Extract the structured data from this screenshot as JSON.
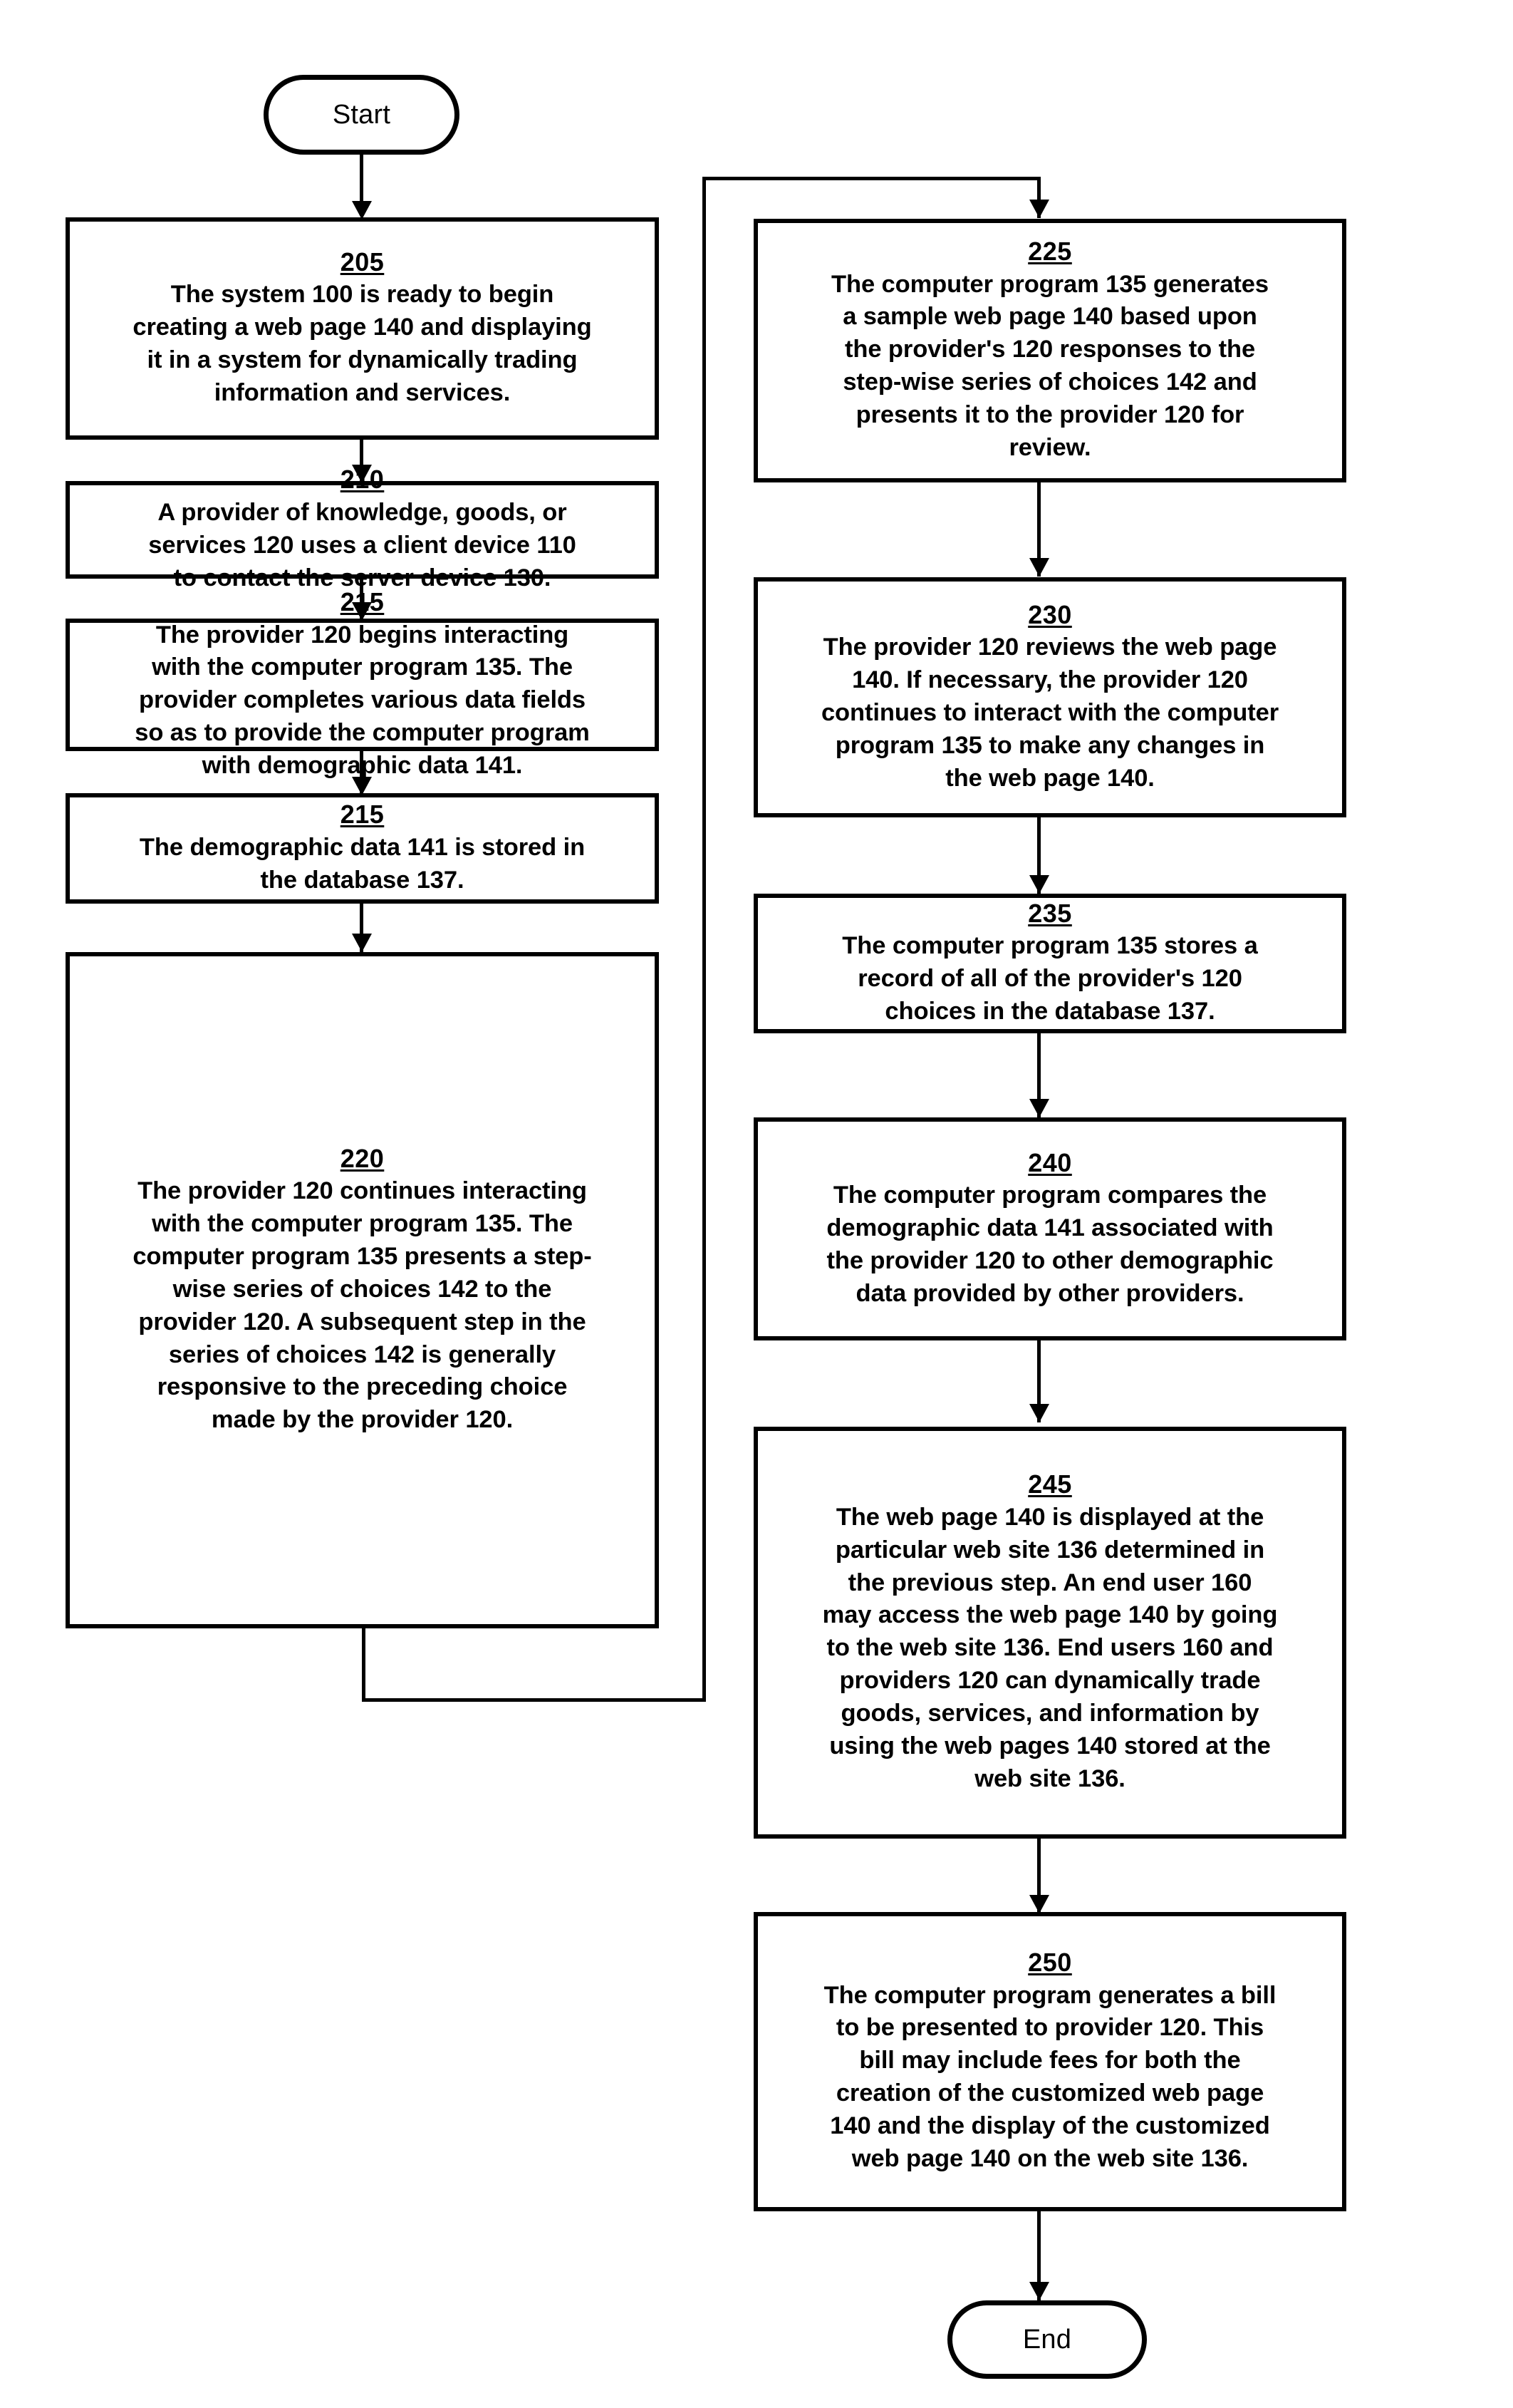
{
  "figure": {
    "type": "patent-flowchart",
    "orientation": "two-column"
  },
  "nodes": {
    "start": {
      "label": "Start"
    },
    "end": {
      "label": "End"
    },
    "steps": [
      {
        "id": "205",
        "number": "205",
        "text": "The system 100 is ready to begin\ncreating a web page 140 and displaying\nit in a system for dynamically trading\ninformation and services."
      },
      {
        "id": "210",
        "number": "210",
        "text": "A provider of knowledge, goods, or\nservices 120 uses a client device 110\nto contact the server device 130."
      },
      {
        "id": "215a",
        "number": "215",
        "text": "The provider 120 begins interacting\nwith the computer program 135.  The\nprovider completes various data fields\nso as to provide the computer program\nwith demographic data 141."
      },
      {
        "id": "215b",
        "number": "215",
        "text": "The demographic data 141 is stored in\nthe database 137."
      },
      {
        "id": "220",
        "number": "220",
        "text": "The provider 120 continues interacting\nwith the computer program 135.  The\ncomputer program 135 presents a step-\nwise series of choices 142 to the\nprovider 120.  A subsequent step in the\nseries of choices 142 is generally\nresponsive to the preceding choice\nmade by the provider 120."
      },
      {
        "id": "225",
        "number": "225",
        "text": "The computer program 135 generates\na sample web page 140 based upon\nthe provider's 120 responses to the\nstep-wise series of choices 142 and\npresents it to the provider 120 for\nreview."
      },
      {
        "id": "230",
        "number": "230",
        "text": "The provider 120 reviews the web page\n140.  If necessary, the provider 120\ncontinues to interact with the computer\nprogram 135 to make any changes in\nthe web page 140."
      },
      {
        "id": "235",
        "number": "235",
        "text": "The computer program 135 stores a\nrecord of all of the provider's 120\nchoices in the database 137."
      },
      {
        "id": "240",
        "number": "240",
        "text": "The computer program compares the\ndemographic data 141 associated with\nthe provider 120 to other demographic\ndata provided by other providers."
      },
      {
        "id": "245",
        "number": "245",
        "text": "The web page 140 is displayed at the\nparticular web site 136 determined in\nthe previous step.  An end user 160\nmay access the web page 140 by going\nto the web site 136.  End users 160 and\nproviders 120 can dynamically trade\ngoods, services, and information by\nusing the web pages 140 stored at the\nweb site 136."
      },
      {
        "id": "250",
        "number": "250",
        "text": "The computer program generates a bill\nto be presented to provider 120.  This\nbill may include fees for both the\ncreation of the customized web page\n140 and the display of the customized\nweb page 140 on the web site 136."
      }
    ]
  },
  "colors": {
    "stroke": "#000000",
    "background": "#ffffff"
  }
}
